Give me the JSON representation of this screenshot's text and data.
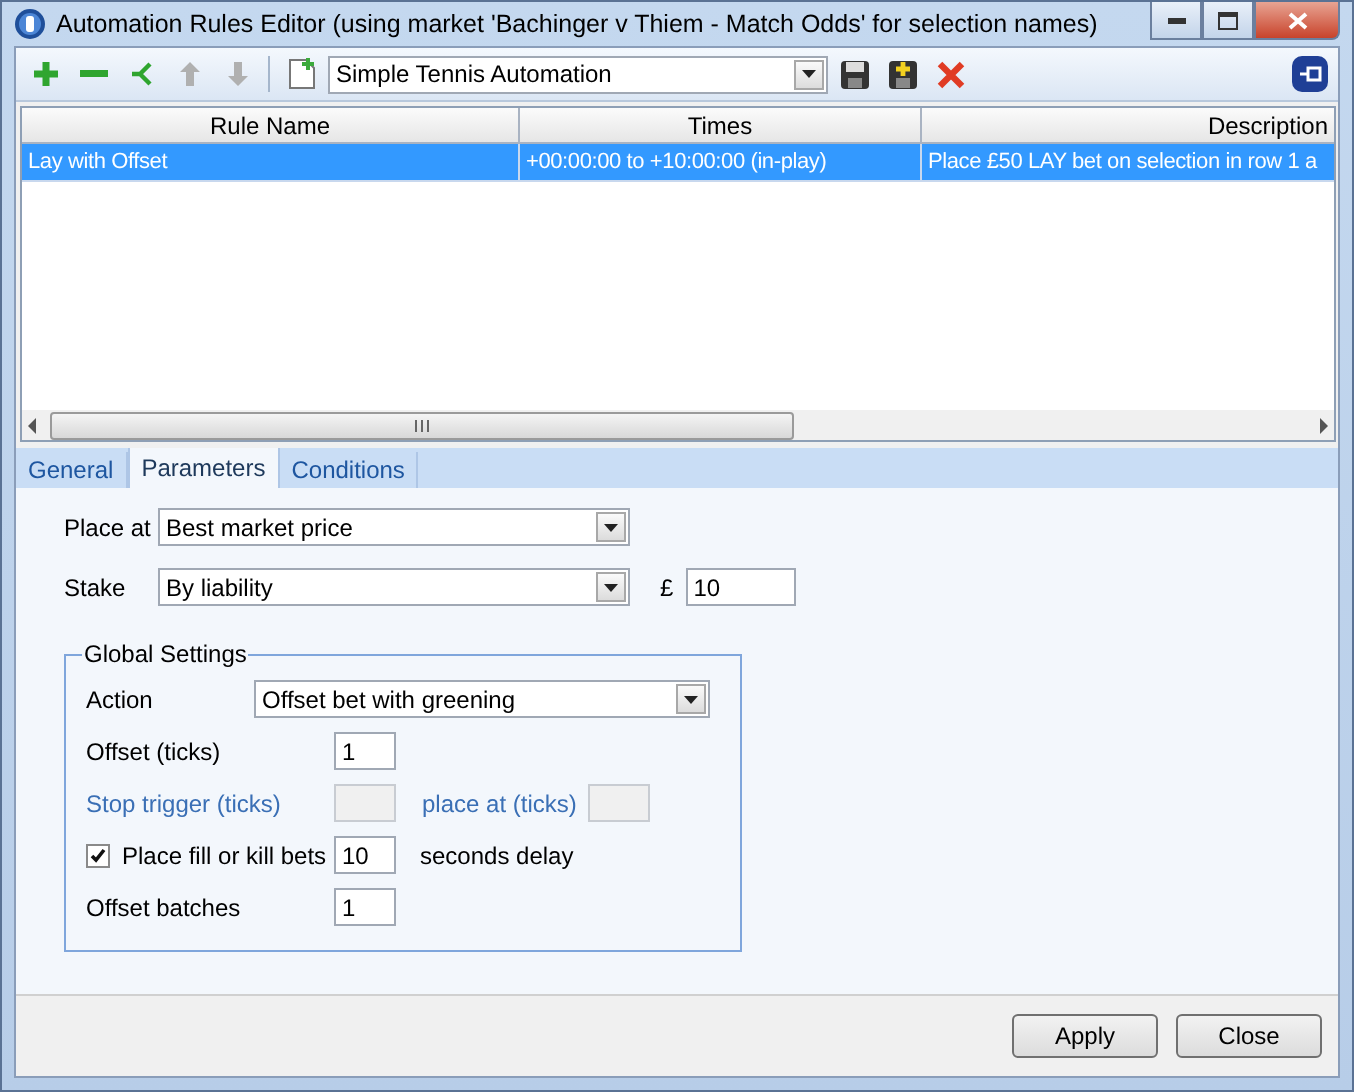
{
  "window": {
    "title": "Automation Rules Editor (using market 'Bachinger v Thiem - Match Odds' for selection names)"
  },
  "toolbar": {
    "rule_set": "Simple Tennis Automation"
  },
  "table": {
    "columns": [
      "Rule Name",
      "Times",
      "Description"
    ],
    "rows": [
      {
        "cells": [
          "Lay with Offset",
          "+00:00:00 to +10:00:00 (in-play)",
          "Place £50 LAY bet on selection in row 1 a"
        ],
        "selected": true
      }
    ]
  },
  "tabs": [
    {
      "label": "General",
      "selected": false
    },
    {
      "label": "Parameters",
      "selected": true
    },
    {
      "label": "Conditions",
      "selected": false
    }
  ],
  "parameters": {
    "place_at": {
      "label": "Place at",
      "value": "Best market price"
    },
    "stake": {
      "label": "Stake",
      "value": "By liability",
      "currency": "£",
      "amount": "10"
    }
  },
  "global_settings": {
    "title": "Global Settings",
    "rows": [
      {
        "kind": "dropdown",
        "label": "Action",
        "value": "Offset bet with greening",
        "disabled": false
      },
      {
        "kind": "field",
        "label": "Offset (ticks)",
        "value": "1",
        "disabled": false
      },
      {
        "kind": "pair",
        "label": "Stop trigger (ticks)",
        "second_label": "place at (ticks)",
        "disabled": true
      },
      {
        "kind": "check",
        "label": "Place fill or kill bets",
        "checked": true,
        "value": "10",
        "suffix": "seconds delay",
        "disabled": false
      },
      {
        "kind": "field",
        "label": "Offset batches",
        "value": "1",
        "disabled": false
      }
    ]
  },
  "buttons": [
    "Apply",
    "Close"
  ]
}
